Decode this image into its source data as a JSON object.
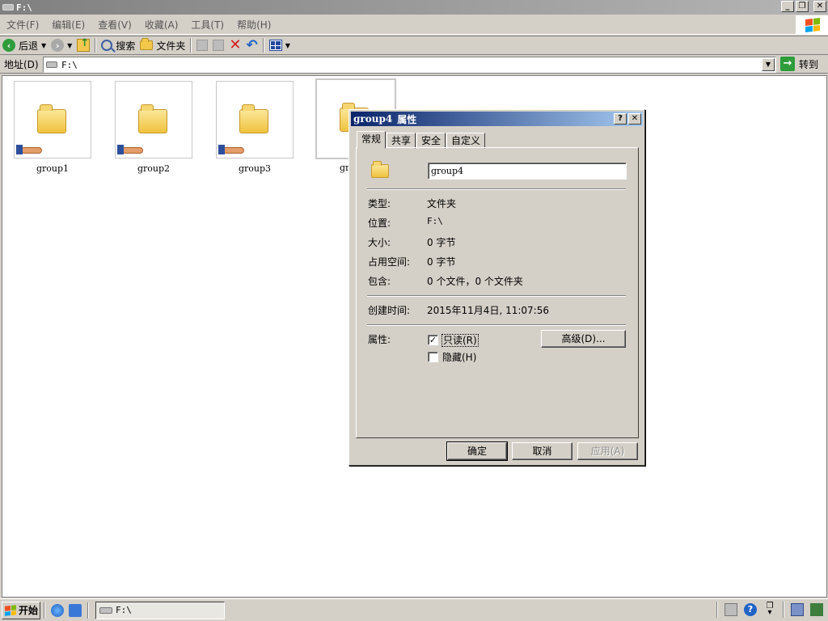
{
  "window": {
    "title": "F:\\"
  },
  "menu": [
    "文件(F)",
    "编辑(E)",
    "查看(V)",
    "收藏(A)",
    "工具(T)",
    "帮助(H)"
  ],
  "toolbar": {
    "back": "后退",
    "search": "搜索",
    "folders": "文件夹"
  },
  "address": {
    "label": "地址(D)",
    "value": "F:\\",
    "go": "转到"
  },
  "items": [
    {
      "name": "group1"
    },
    {
      "name": "group2"
    },
    {
      "name": "group3"
    },
    {
      "name": "gr"
    }
  ],
  "dialog": {
    "title_name": "group4",
    "title_suffix": "属性",
    "help_btn": "?",
    "close_btn": "✕",
    "tabs": [
      "常规",
      "共享",
      "安全",
      "自定义"
    ],
    "name_value": "group4",
    "fields": {
      "type": {
        "label": "类型:",
        "value": "文件夹"
      },
      "location": {
        "label": "位置:",
        "value": "F:\\"
      },
      "size": {
        "label": "大小:",
        "value": "0 字节"
      },
      "size_on_disk": {
        "label": "占用空间:",
        "value": "0 字节"
      },
      "contains": {
        "label": "包含:",
        "value": "0 个文件，0 个文件夹"
      },
      "created": {
        "label": "创建时间:",
        "value": "2015年11月4日, 11:07:56"
      },
      "attributes": {
        "label": "属性:"
      }
    },
    "readonly": {
      "label": "只读(R)",
      "checked": true
    },
    "hidden": {
      "label": "隐藏(H)",
      "checked": false
    },
    "advanced_btn": "高级(D)...",
    "ok_btn": "确定",
    "cancel_btn": "取消",
    "apply_btn": "应用(A)"
  },
  "taskbar": {
    "start": "开始",
    "task_title": "F:\\"
  },
  "colors": {
    "dialog_title_start": "#0a246a",
    "dialog_title_end": "#a6caf0",
    "window_face": "#d4d0c8"
  }
}
